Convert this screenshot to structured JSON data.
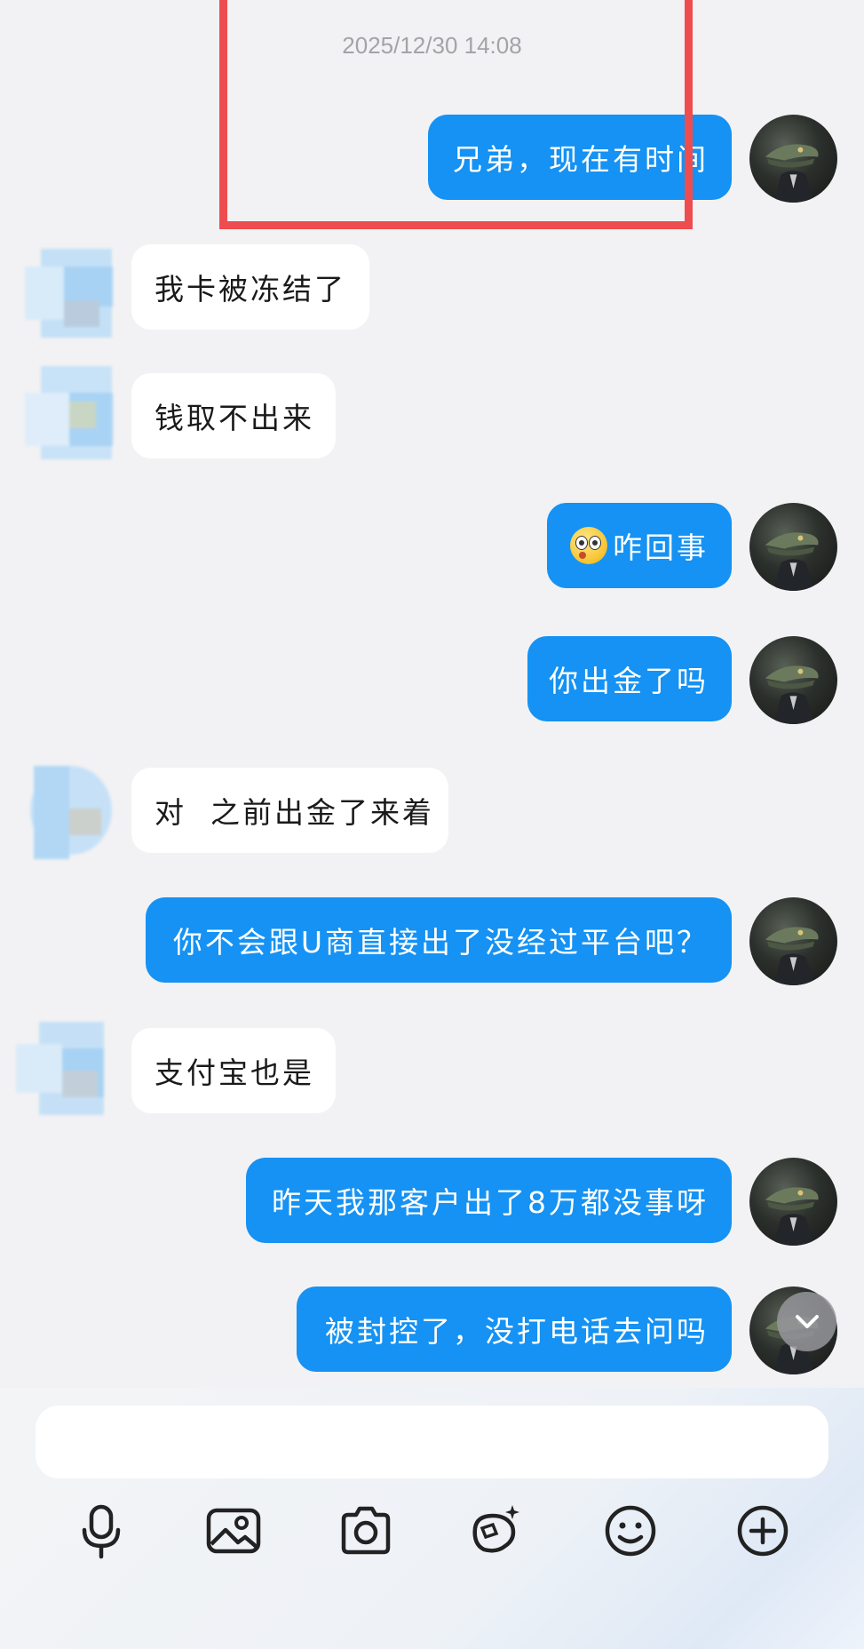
{
  "chat": {
    "timestamp": "2025/12/30 14:08",
    "messages": [
      {
        "side": "out",
        "text": "兄弟，现在有时间"
      },
      {
        "side": "in",
        "text": "我卡被冻结了"
      },
      {
        "side": "in",
        "text": "钱取不出来"
      },
      {
        "side": "out",
        "emoji": "surprised-face-emoji",
        "text": "咋回事"
      },
      {
        "side": "out",
        "text": "你出金了吗"
      },
      {
        "side": "in",
        "text": "对  之前出金了来着"
      },
      {
        "side": "out",
        "text": "你不会跟U商直接出了没经过平台吧？"
      },
      {
        "side": "in",
        "text": "支付宝也是"
      },
      {
        "side": "out",
        "text": "昨天我那客户出了8万都没事呀"
      },
      {
        "side": "out",
        "text": "被封控了，没打电话去问吗"
      }
    ]
  },
  "composer": {
    "input_value": "",
    "tools": [
      "microphone-icon",
      "image-icon",
      "camera-icon",
      "sticker-icon",
      "smiley-icon",
      "plus-circle-icon"
    ]
  },
  "colors": {
    "outgoing_bubble": "#1592f3",
    "incoming_bubble": "#ffffff",
    "background": "#f2f2f4",
    "highlight_box": "#ee4d4f"
  }
}
